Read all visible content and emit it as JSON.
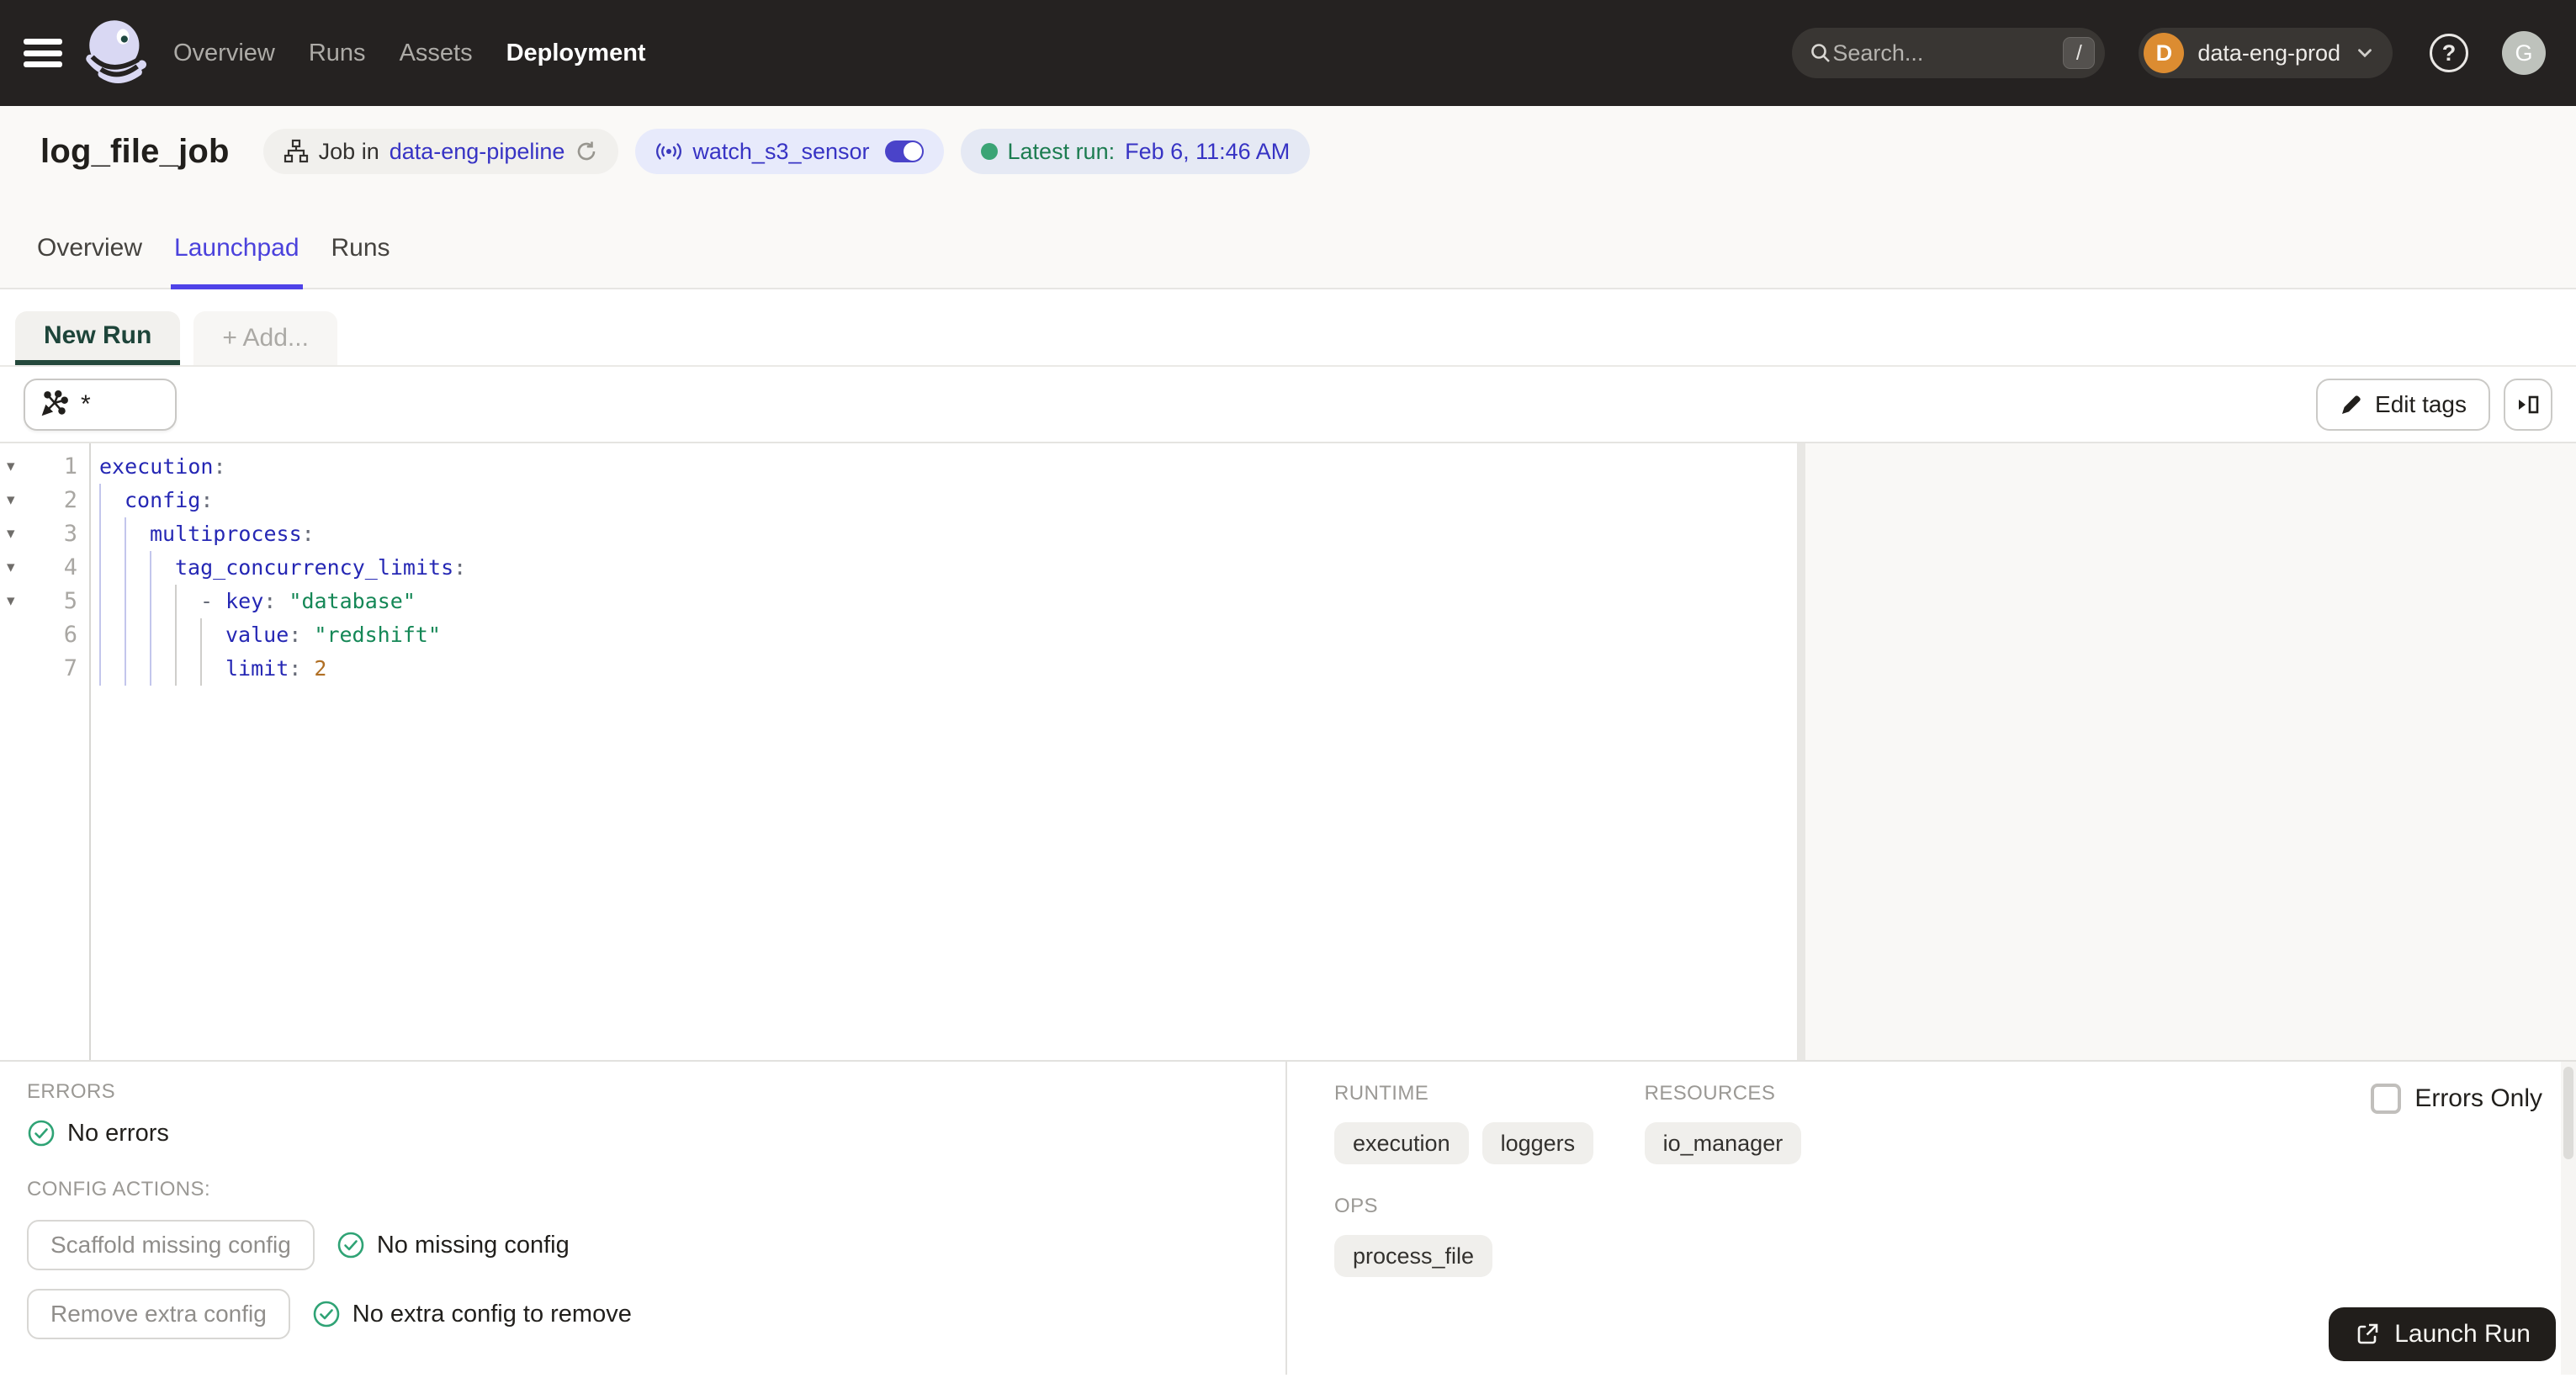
{
  "colors": {
    "accent": "#4F43E8",
    "link": "#3733C4",
    "nav_bg": "#252221",
    "green": "#2FA375",
    "green_text": "#1C7C50",
    "new_run_green": "#25493C",
    "org_badge_orange": "#DC8C31",
    "launch_bg": "#211E1B",
    "code_key": "#2527B4",
    "code_string": "#148756",
    "code_number": "#B06F24"
  },
  "nav": {
    "items": [
      {
        "label": "Overview",
        "active": false
      },
      {
        "label": "Runs",
        "active": false
      },
      {
        "label": "Assets",
        "active": false
      },
      {
        "label": "Deployment",
        "active": true
      }
    ],
    "search": {
      "placeholder": "Search...",
      "shortcut": "/"
    },
    "org": {
      "initial": "D",
      "name": "data-eng-prod"
    },
    "user_initial": "G"
  },
  "header": {
    "title": "log_file_job",
    "job_pill": {
      "prefix": "Job in",
      "link": "data-eng-pipeline"
    },
    "sensor_pill": {
      "label": "watch_s3_sensor"
    },
    "latest_pill": {
      "prefix": "Latest run:",
      "value": "Feb 6, 11:46 AM"
    }
  },
  "tabs": [
    {
      "label": "Overview",
      "active": false
    },
    {
      "label": "Launchpad",
      "active": true
    },
    {
      "label": "Runs",
      "active": false
    }
  ],
  "run_tabs": {
    "active": "New Run",
    "add": "+ Add..."
  },
  "toolbar": {
    "op_query": "*",
    "edit_tags": "Edit tags"
  },
  "editor": {
    "lines": [
      {
        "n": 1,
        "fold": true,
        "guides": 0,
        "tokens": [
          {
            "t": "k",
            "v": "execution"
          },
          {
            "t": "p",
            "v": ":"
          }
        ]
      },
      {
        "n": 2,
        "fold": true,
        "guides": 1,
        "tokens": [
          {
            "t": "k",
            "v": "config"
          },
          {
            "t": "p",
            "v": ":"
          }
        ]
      },
      {
        "n": 3,
        "fold": true,
        "guides": 2,
        "tokens": [
          {
            "t": "k",
            "v": "multiprocess"
          },
          {
            "t": "p",
            "v": ":"
          }
        ]
      },
      {
        "n": 4,
        "fold": true,
        "guides": 3,
        "tokens": [
          {
            "t": "k",
            "v": "tag_concurrency_limits"
          },
          {
            "t": "p",
            "v": ":"
          }
        ]
      },
      {
        "n": 5,
        "fold": true,
        "guides": 4,
        "tokens": [
          {
            "t": "p",
            "v": "- "
          },
          {
            "t": "k",
            "v": "key"
          },
          {
            "t": "p",
            "v": ":"
          },
          {
            "t": "w",
            "v": " "
          },
          {
            "t": "s",
            "v": "\"database\""
          }
        ]
      },
      {
        "n": 6,
        "fold": false,
        "guides": 5,
        "tokens": [
          {
            "t": "k",
            "v": "value"
          },
          {
            "t": "p",
            "v": ":"
          },
          {
            "t": "w",
            "v": " "
          },
          {
            "t": "s",
            "v": "\"redshift\""
          }
        ]
      },
      {
        "n": 7,
        "fold": false,
        "guides": 5,
        "tokens": [
          {
            "t": "k",
            "v": "limit"
          },
          {
            "t": "p",
            "v": ":"
          },
          {
            "t": "w",
            "v": " "
          },
          {
            "t": "n",
            "v": "2"
          }
        ]
      }
    ]
  },
  "panel_left": {
    "errors_label": "ERRORS",
    "no_errors": "No errors",
    "config_actions_label": "CONFIG ACTIONS:",
    "actions": [
      {
        "button": "Scaffold missing config",
        "status": "No missing config"
      },
      {
        "button": "Remove extra config",
        "status": "No extra config to remove"
      }
    ]
  },
  "panel_right": {
    "runtime_label": "RUNTIME",
    "resources_label": "RESOURCES",
    "ops_label": "OPS",
    "runtime_tags": [
      "execution",
      "loggers"
    ],
    "resource_tags": [
      "io_manager"
    ],
    "op_tags": [
      "process_file"
    ],
    "errors_only_label": "Errors Only",
    "launch_label": "Launch Run"
  }
}
